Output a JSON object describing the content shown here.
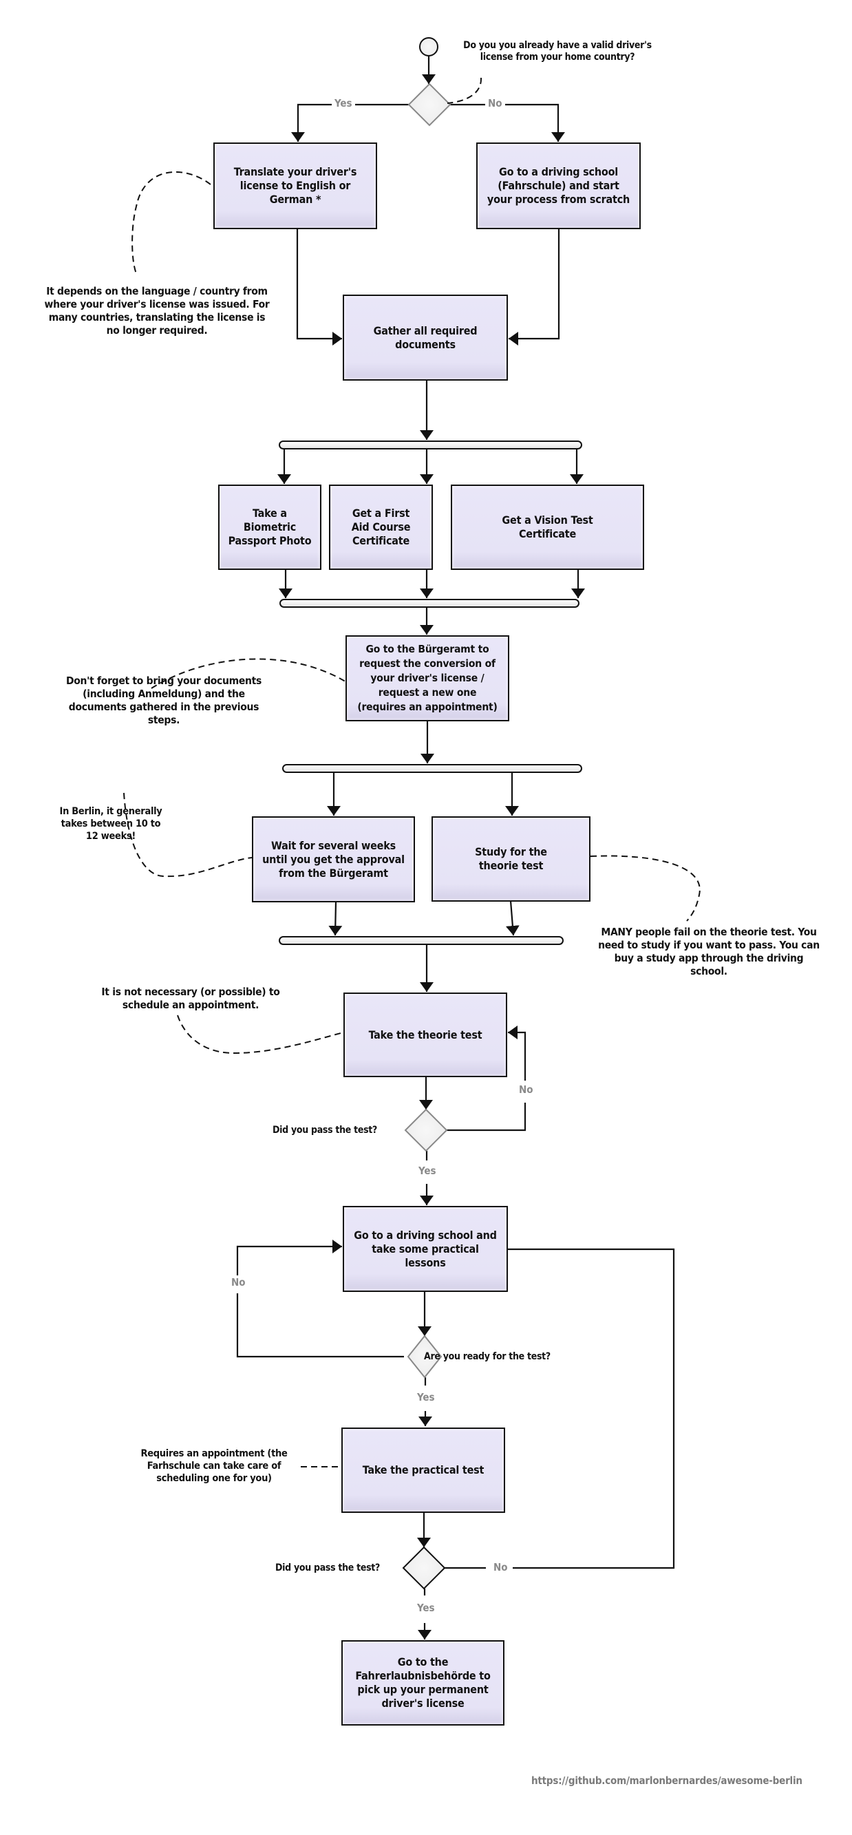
{
  "start_question": "Do you you already have a valid driver's license from your home country?",
  "decision_labels": {
    "yes": "Yes",
    "no": "No"
  },
  "steps": {
    "translate": "Translate your driver's license to English or German *",
    "driving_school_start": "Go to a driving school (Fahrschule) and start your process from scratch",
    "gather_documents": "Gather all required documents",
    "passport_photo": "Take a Biometric Passport Photo",
    "first_aid": "Get a First Aid Course Certificate",
    "vision_test": "Get a Vision Test Certificate",
    "buergeramt": "Go to the Bürgeramt to request the conversion of your driver's license / request a new one (requires an appointment)",
    "wait_approval": "Wait for several weeks until you get the approval from the Bürgeramt",
    "study_theorie": "Study for the theorie test",
    "take_theorie": "Take the theorie test",
    "practical_lessons": "Go to a driving school and take some practical lessons",
    "take_practical": "Take the practical test",
    "pickup_license": "Go to the Fahrerlaubnisbehörde to pick up your permanent driver's license"
  },
  "questions": {
    "theorie_passed": "Did you pass the test?",
    "ready_for_test": "Are you ready for the test?",
    "practical_passed": "Did you pass the test?"
  },
  "notes": {
    "translation_note": "It depends on the language / country from where your driver's license was issued. For many countries, translating the license is no longer required.",
    "documents_note": "Don't forget to bring your documents (including Anmeldung) and the documents gathered in the previous steps.",
    "berlin_wait_note": "In Berlin, it generally takes between 10 to 12 weeks!",
    "theorie_fail_note": "MANY people fail on the theorie test. You need to study if you want to pass. You can buy a study app through the driving school.",
    "no_appointment_note": "It is not necessary (or possible) to schedule an appointment.",
    "practical_appointment_note": "Requires an appointment (the Farhschule can take care of scheduling one for you)"
  },
  "footer_url": "https://github.com/marlonbernardes/awesome-berlin",
  "colors": {
    "node_fill": "#e7e4f7",
    "line": "#111111",
    "decision_label": "#8a8a8a",
    "start_diamond_stroke": "#888888"
  }
}
